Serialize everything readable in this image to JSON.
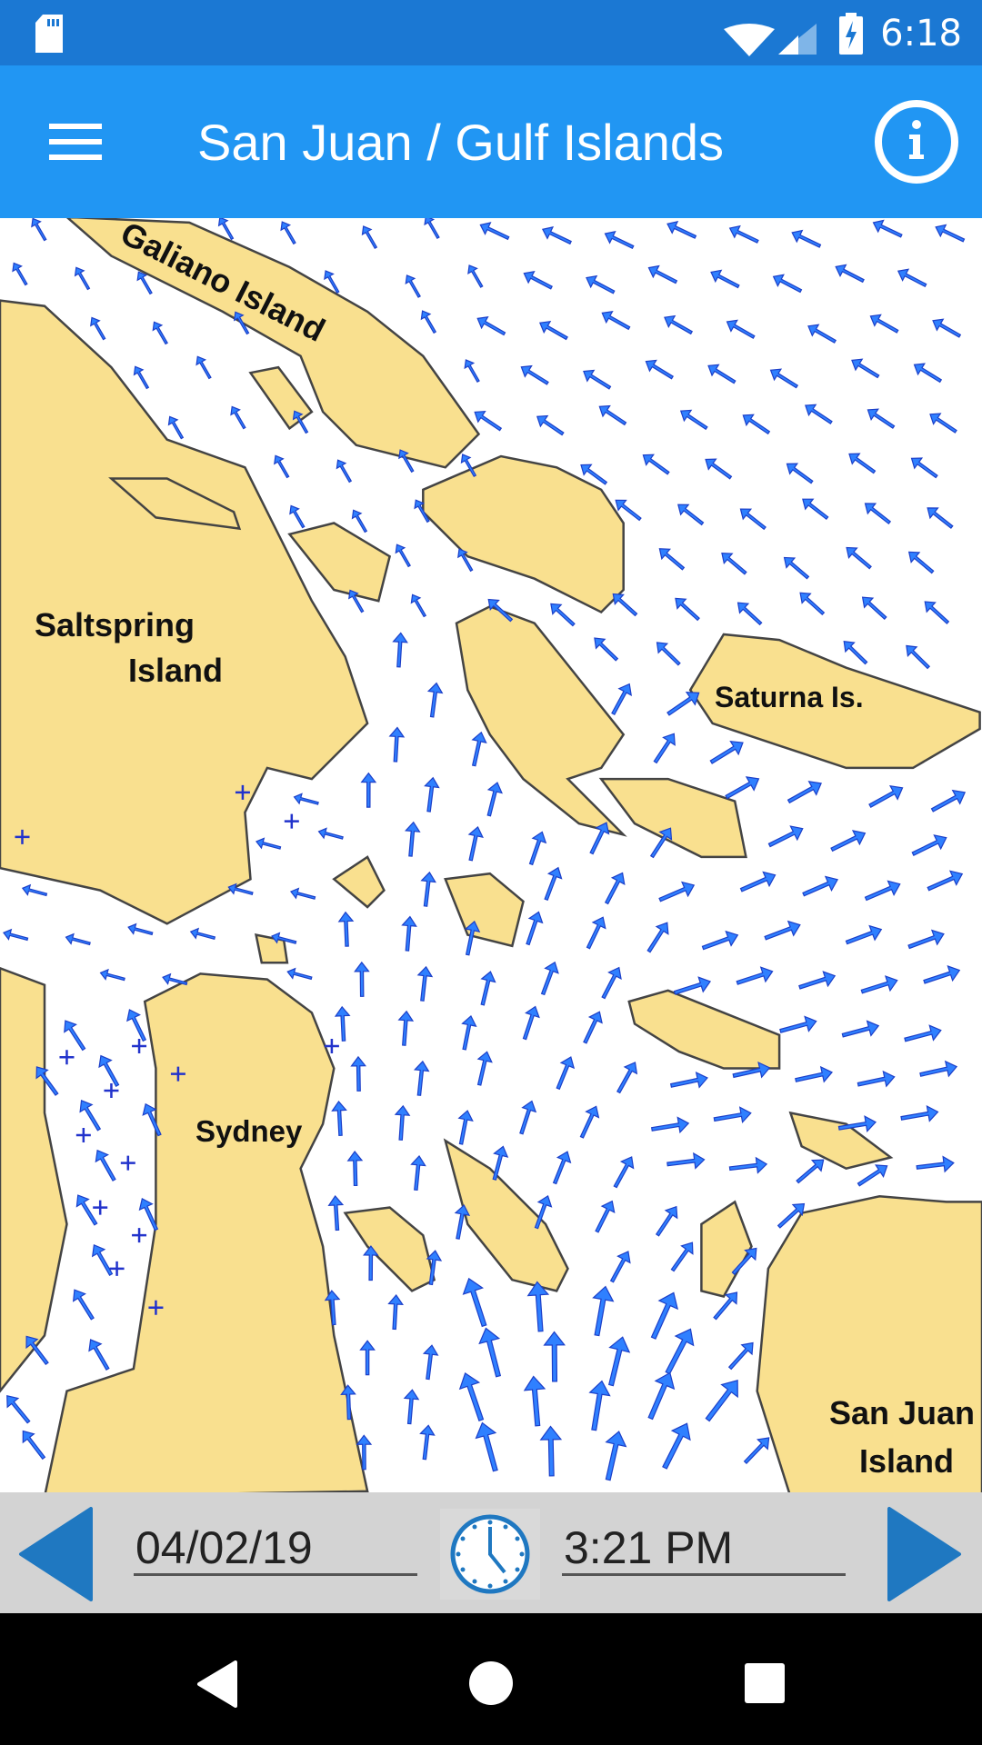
{
  "status_bar": {
    "time": "6:18",
    "icons": [
      "sd-card-icon",
      "wifi-icon",
      "cell-signal-icon",
      "battery-charging-icon"
    ]
  },
  "app_bar": {
    "title": "San Juan / Gulf Islands",
    "menu_icon": "hamburger-menu-icon",
    "info_icon": "info-icon",
    "color": "#2196F3"
  },
  "map": {
    "labels": {
      "galiano": "Galiano Island",
      "saltspring_1": "Saltspring",
      "saltspring_2": "Island",
      "saturna": "Saturna Is.",
      "sydney": "Sydney",
      "san_juan_1": "San Juan",
      "san_juan_2": "Island"
    },
    "land_color": "#F9E08F",
    "current_arrow_color": "#2F80FF"
  },
  "controls": {
    "date": "04/02/19",
    "time": "3:21 PM",
    "prev_icon": "triangle-left-icon",
    "next_icon": "triangle-right-icon",
    "clock_icon": "clock-icon"
  },
  "nav_bar": {
    "icons": [
      "back-icon",
      "home-icon",
      "recents-icon"
    ]
  }
}
